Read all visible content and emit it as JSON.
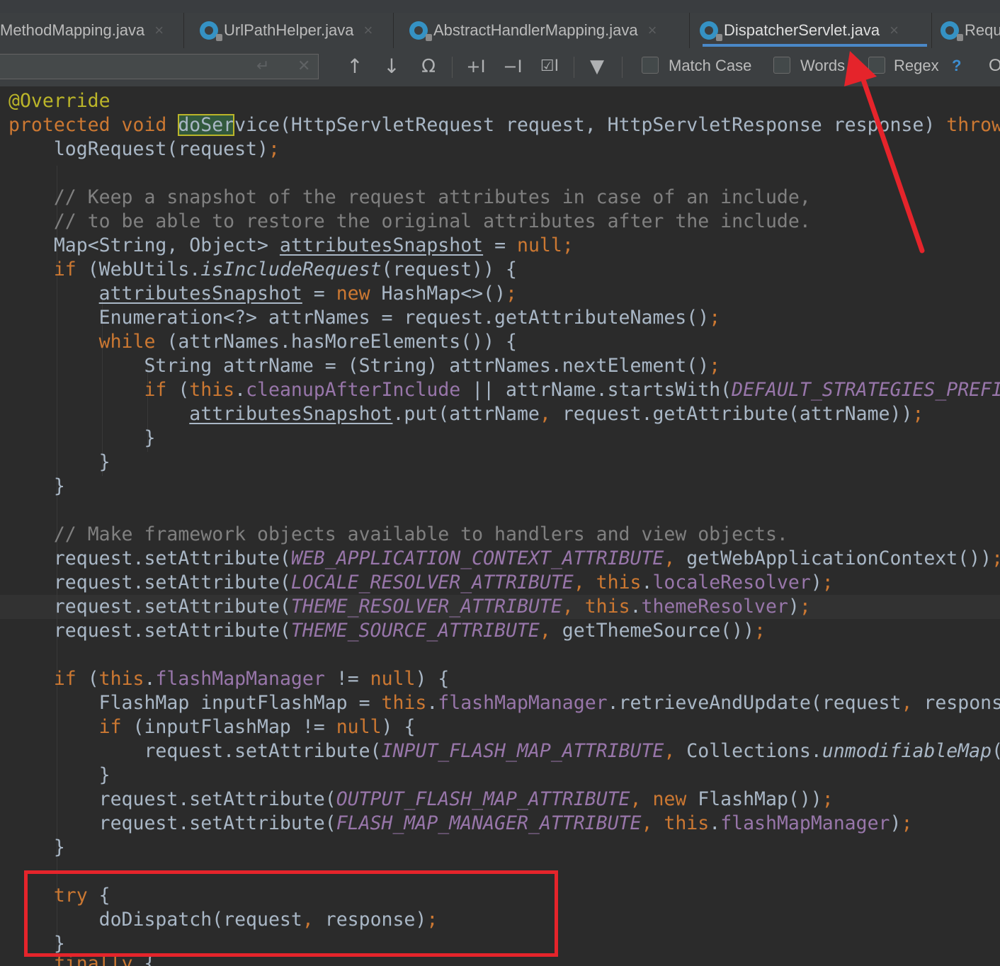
{
  "tabs": [
    {
      "label": "MethodMapping.java",
      "active": false
    },
    {
      "label": "UrlPathHelper.java",
      "active": false
    },
    {
      "label": "AbstractHandlerMapping.java",
      "active": false
    },
    {
      "label": "DispatcherServlet.java",
      "active": true
    },
    {
      "label": "Requ",
      "active": false
    }
  ],
  "find": {
    "query": "",
    "match_case_label": "Match Case",
    "words_label": "Words",
    "regex_label": "Regex",
    "help_label": "?",
    "more_label": "O"
  },
  "code": {
    "l1": "@Override",
    "l2_kw": "protected void ",
    "l2_hl": "doSer",
    "l2_rest": "vice",
    "l2_params": "(HttpServletRequest request, HttpServletResponse response) ",
    "l2_throw": "throw",
    "l3": "logRequest(request)",
    "c1": "// Keep a snapshot of the request attributes in case of an include,",
    "c2": "// to be able to restore the original attributes after the include.",
    "map_decl": "Map<String, Object> ",
    "snapshot": "attributesSnapshot",
    "null": "null",
    "if": "if",
    "webutils": " (WebUtils.",
    "is_include": "isIncludeRequest",
    "req_brace": "(request)) {",
    "new": "new",
    "hashmap": " HashMap<>()",
    "enum_line": "Enumeration<?> attrNames = request.getAttributeNames()",
    "while": "while",
    "while_rest": " (attrNames.hasMoreElements()) {",
    "string_line": "String attrName = (String) attrNames.nextElement()",
    "this": "this",
    "cleanup": "cleanupAfterInclude",
    "or_starts": " || attrName.startsWith(",
    "default_prefix": "DEFAULT_STRATEGIES_PREFI",
    "put_rest": ".put(attrName",
    "put_tail": " request.getAttribute(attrName))",
    "c3": "// Make framework objects available to handlers and view objects.",
    "set_attr": "request.setAttribute(",
    "web_ctx": "WEB_APPLICATION_CONTEXT_ATTRIBUTE",
    "get_web_ctx": " getWebApplicationContext())",
    "locale_attr": "LOCALE_RESOLVER_ATTRIBUTE",
    "locale_res": "localeResolver",
    "theme_attr": "THEME_RESOLVER_ATTRIBUTE",
    "theme_res": "themeResolver",
    "theme_src": "THEME_SOURCE_ATTRIBUTE",
    "get_theme_src": " getThemeSource())",
    "flash_mgr": "flashMapManager",
    "neq": " != ",
    "flashmap_decl": "FlashMap inputFlashMap = ",
    "retrieve": ".retrieveAndUpdate(request",
    "respons": " respons",
    "if_input": " (inputFlashMap != ",
    "input_attr": "INPUT_FLASH_MAP_ATTRIBUTE",
    "collections": " Collections.",
    "unmod": "unmodifiableMap",
    "output_attr": "OUTPUT_FLASH_MAP_ATTRIBUTE",
    "flashmap_new": " FlashMap())",
    "mgr_attr": "FLASH_MAP_MANAGER_ATTRIBUTE",
    "try": "try",
    "dispatch": "doDispatch(request",
    "response": " response)",
    "finally": "finally"
  },
  "colors": {
    "red_annotation": "#e5242b",
    "keyword": "#cc7832",
    "field": "#9876aa",
    "comment": "#808080",
    "annotation": "#bbb529"
  }
}
